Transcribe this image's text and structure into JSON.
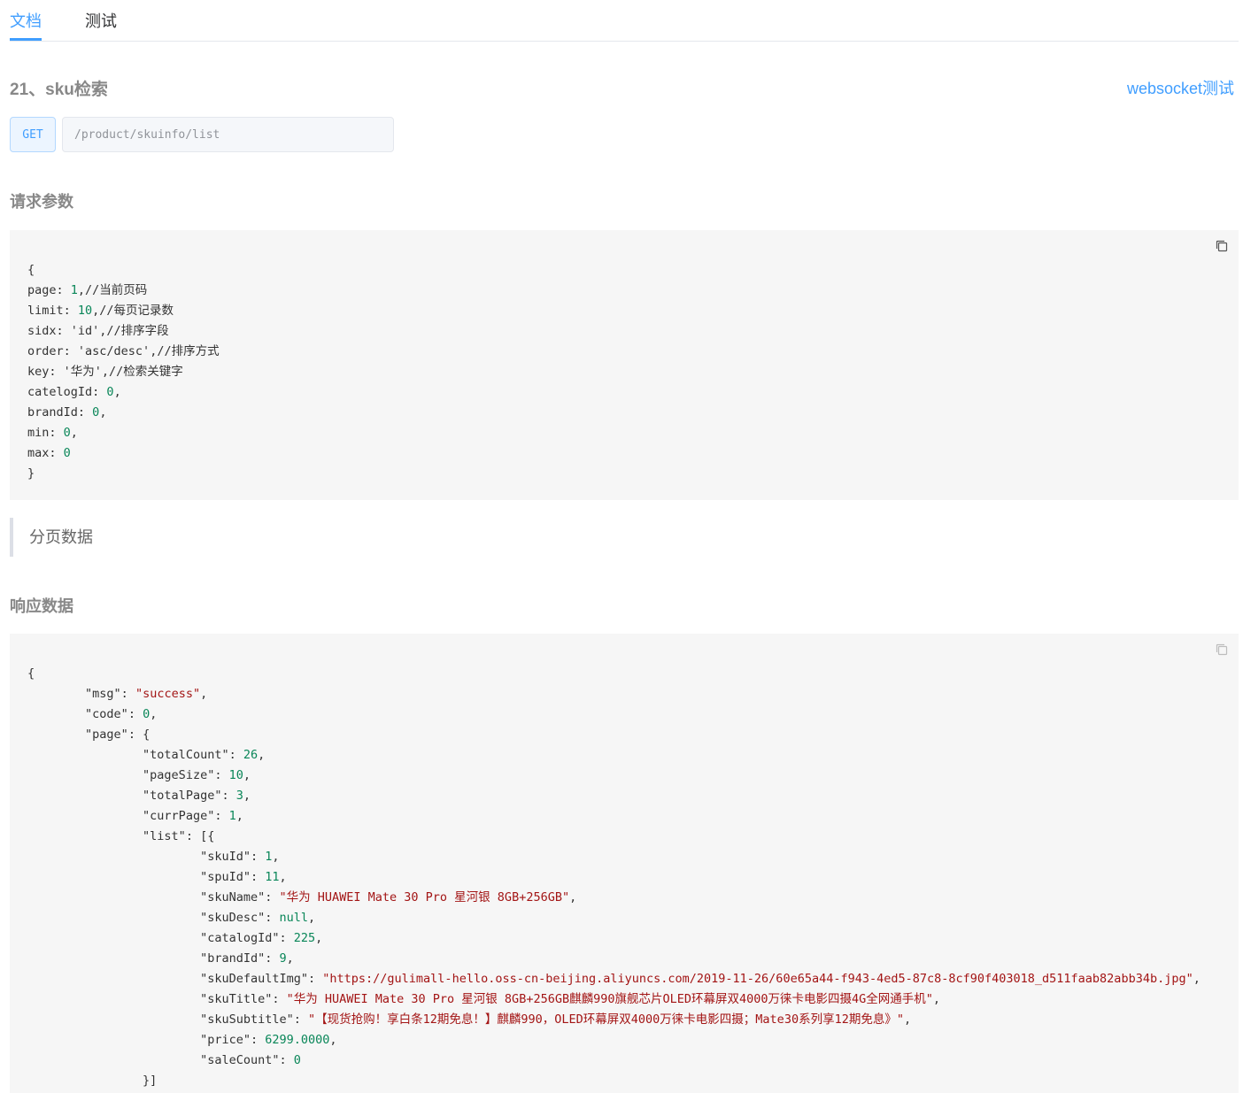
{
  "tabs": [
    {
      "label": "文档",
      "active": true
    },
    {
      "label": "测试",
      "active": false
    }
  ],
  "api": {
    "title": "21、sku检索",
    "ws_link": "websocket测试",
    "method": "GET",
    "url": "/product/skuinfo/list"
  },
  "request": {
    "title": "请求参数",
    "open": "{",
    "close": "}",
    "lines": [
      {
        "key": "page",
        "val": "1",
        "type": "num",
        "tail": ",//当前页码"
      },
      {
        "key": "limit",
        "val": "10",
        "type": "num",
        "tail": ",//每页记录数"
      },
      {
        "key": "sidx",
        "val": "'id'",
        "type": "plain",
        "tail": ",//排序字段"
      },
      {
        "key": "order",
        "val": "'asc/desc'",
        "type": "plain",
        "tail": ",//排序方式"
      },
      {
        "key": "key",
        "val": "'华为'",
        "type": "plain",
        "tail": ",//检索关键字"
      },
      {
        "key": "catelogId",
        "val": "0",
        "type": "num",
        "tail": ","
      },
      {
        "key": "brandId",
        "val": "0",
        "type": "num",
        "tail": ","
      },
      {
        "key": "min",
        "val": "0",
        "type": "num",
        "tail": ","
      },
      {
        "key": "max",
        "val": "0",
        "type": "num",
        "tail": ""
      }
    ]
  },
  "note": "分页数据",
  "response": {
    "title": "响应数据",
    "lines": [
      {
        "indent": 0,
        "text": "{"
      },
      {
        "indent": 1,
        "key": "\"msg\"",
        "val": "\"success\"",
        "type": "str",
        "tail": ","
      },
      {
        "indent": 1,
        "key": "\"code\"",
        "val": "0",
        "type": "num",
        "tail": ","
      },
      {
        "indent": 1,
        "key": "\"page\"",
        "val": "",
        "type": "plain",
        "tail": "{"
      },
      {
        "indent": 2,
        "key": "\"totalCount\"",
        "val": "26",
        "type": "num",
        "tail": ","
      },
      {
        "indent": 2,
        "key": "\"pageSize\"",
        "val": "10",
        "type": "num",
        "tail": ","
      },
      {
        "indent": 2,
        "key": "\"totalPage\"",
        "val": "3",
        "type": "num",
        "tail": ","
      },
      {
        "indent": 2,
        "key": "\"currPage\"",
        "val": "1",
        "type": "num",
        "tail": ","
      },
      {
        "indent": 2,
        "key": "\"list\"",
        "val": "",
        "type": "plain",
        "tail": "[{"
      },
      {
        "indent": 3,
        "key": "\"skuId\"",
        "val": "1",
        "type": "num",
        "tail": ","
      },
      {
        "indent": 3,
        "key": "\"spuId\"",
        "val": "11",
        "type": "num",
        "tail": ","
      },
      {
        "indent": 3,
        "key": "\"skuName\"",
        "val": "\"华为 HUAWEI Mate 30 Pro 星河银 8GB+256GB\"",
        "type": "str",
        "tail": ","
      },
      {
        "indent": 3,
        "key": "\"skuDesc\"",
        "val": "null",
        "type": "num",
        "tail": ","
      },
      {
        "indent": 3,
        "key": "\"catalogId\"",
        "val": "225",
        "type": "num",
        "tail": ","
      },
      {
        "indent": 3,
        "key": "\"brandId\"",
        "val": "9",
        "type": "num",
        "tail": ","
      },
      {
        "indent": 3,
        "key": "\"skuDefaultImg\"",
        "val": "\"https://gulimall-hello.oss-cn-beijing.aliyuncs.com/2019-11-26/60e65a44-f943-4ed5-87c8-8cf90f403018_d511faab82abb34b.jpg\"",
        "type": "str",
        "tail": ","
      },
      {
        "indent": 3,
        "key": "\"skuTitle\"",
        "val": "\"华为 HUAWEI Mate 30 Pro 星河银 8GB+256GB麒麟990旗舰芯片OLED环幕屏双4000万徕卡电影四摄4G全网通手机\"",
        "type": "str",
        "tail": ","
      },
      {
        "indent": 3,
        "key": "\"skuSubtitle\"",
        "val": "\"【现货抢购！享白条12期免息！】麒麟990，OLED环幕屏双4000万徕卡电影四摄；Mate30系列享12期免息》\"",
        "type": "str",
        "tail": ","
      },
      {
        "indent": 3,
        "key": "\"price\"",
        "val": "6299.0000",
        "type": "num",
        "tail": ","
      },
      {
        "indent": 3,
        "key": "\"saleCount\"",
        "val": "0",
        "type": "num",
        "tail": ""
      },
      {
        "indent": 2,
        "text": "}]"
      }
    ]
  },
  "icons": {
    "copy": "copy-icon"
  },
  "colors": {
    "accent": "#409eff",
    "code_bg": "#f6f6f6",
    "number": "#098658",
    "string": "#a31515"
  }
}
